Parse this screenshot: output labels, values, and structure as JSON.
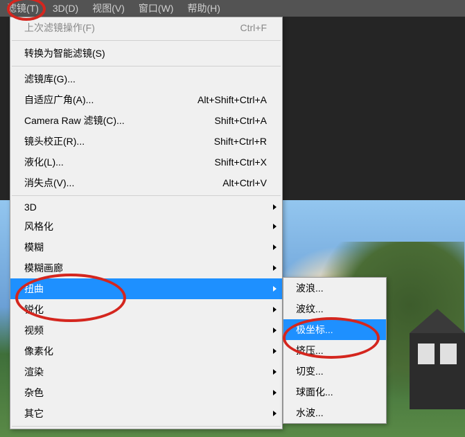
{
  "menubar": {
    "filter": "滤镜(T)",
    "threeD": "3D(D)",
    "view": "视图(V)",
    "window": "窗口(W)",
    "help": "帮助(H)"
  },
  "menu": {
    "lastFilter": {
      "label": "上次滤镜操作(F)",
      "shortcut": "Ctrl+F"
    },
    "convertSmart": {
      "label": "转换为智能滤镜(S)"
    },
    "filterGallery": {
      "label": "滤镜库(G)..."
    },
    "adaptiveWide": {
      "label": "自适应广角(A)...",
      "shortcut": "Alt+Shift+Ctrl+A"
    },
    "cameraRaw": {
      "label": "Camera Raw 滤镜(C)...",
      "shortcut": "Shift+Ctrl+A"
    },
    "lensCorrect": {
      "label": "镜头校正(R)...",
      "shortcut": "Shift+Ctrl+R"
    },
    "liquify": {
      "label": "液化(L)...",
      "shortcut": "Shift+Ctrl+X"
    },
    "vanishing": {
      "label": "消失点(V)...",
      "shortcut": "Alt+Ctrl+V"
    },
    "threeD": {
      "label": "3D"
    },
    "stylize": {
      "label": "风格化"
    },
    "blur": {
      "label": "模糊"
    },
    "blurGallery": {
      "label": "模糊画廊"
    },
    "distort": {
      "label": "扭曲"
    },
    "sharpen": {
      "label": "锐化"
    },
    "video": {
      "label": "视频"
    },
    "pixelate": {
      "label": "像素化"
    },
    "render": {
      "label": "渲染"
    },
    "noise": {
      "label": "杂色"
    },
    "other": {
      "label": "其它"
    }
  },
  "submenu": {
    "wave": "波浪...",
    "ripple": "波纹...",
    "polar": "极坐标...",
    "pinch": "挤压...",
    "shear": "切变...",
    "spherize": "球面化...",
    "zigzag": "水波..."
  }
}
